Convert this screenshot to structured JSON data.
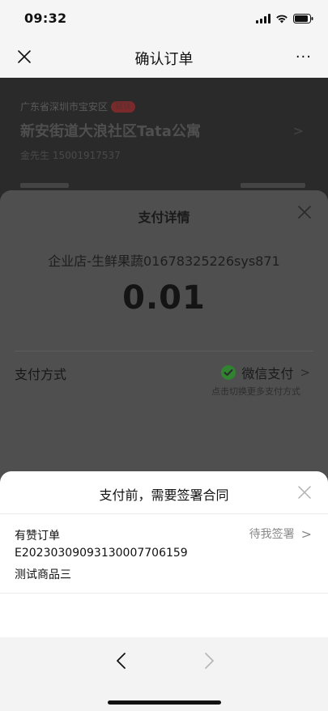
{
  "status_bar": {
    "time": "09:32"
  },
  "navbar": {
    "title": "确认订单",
    "more_label": "···"
  },
  "address": {
    "region": "广东省深圳市宝安区",
    "tag": "默认",
    "line": "新安街道大浪社区Tata公寓",
    "contact": "金先生 15001917537",
    "arrow": ">"
  },
  "payment": {
    "title": "支付详情",
    "merchant": "企业店-生鲜果蔬01678325226sys871",
    "amount": "0.01",
    "method_label": "支付方式",
    "method_value": "微信支付",
    "method_hint": "点击切换更多支付方式"
  },
  "contract": {
    "title": "支付前，需要签署合同",
    "item": {
      "name": "有赞订单",
      "status": "待我签署",
      "code": "E20230309093130007706159",
      "product": "测试商品三"
    }
  },
  "colors": {
    "wechat_green": "#1aad19",
    "overlay": "#2a2a2a",
    "sheet_dim": "#4f4f4f",
    "sheet_light": "#ffffff"
  },
  "icons": {
    "close": "close-icon",
    "more": "more-icon",
    "wechat": "wechat-pay-icon",
    "chevron_right": "chevron-right-icon",
    "back": "chevron-left-icon",
    "forward": "chevron-right-icon"
  }
}
